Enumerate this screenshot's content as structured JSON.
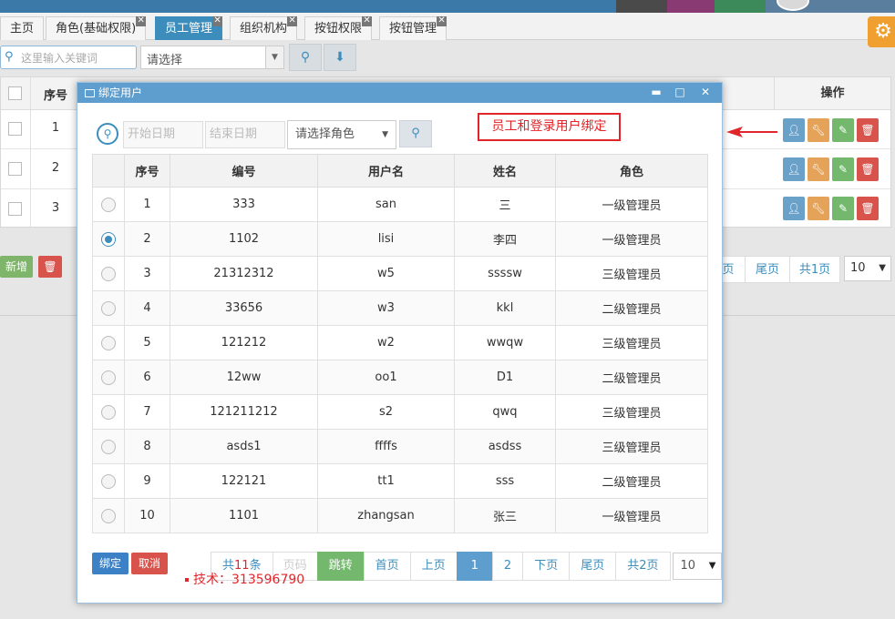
{
  "tabs": [
    {
      "label": "主页",
      "active": false
    },
    {
      "label": "角色(基础权限)",
      "active": false
    },
    {
      "label": "员工管理",
      "active": true
    },
    {
      "label": "组织机构",
      "active": false
    },
    {
      "label": "按钮权限",
      "active": false
    },
    {
      "label": "按钮管理",
      "active": false
    }
  ],
  "toolbar": {
    "search_placeholder": "这里输入关键词",
    "select_value": "请选择"
  },
  "bg_table": {
    "col_seq": "序号",
    "col_ops": "操作",
    "rows": [
      "1",
      "2",
      "3"
    ]
  },
  "bg_actions": {
    "add_label": "新增"
  },
  "bg_pager": {
    "prev": "页",
    "last": "尾页",
    "total": "共1页",
    "size": "10"
  },
  "annotation": {
    "text": "员工和登录用户绑定"
  },
  "tech_note": {
    "text": "技术：313596790"
  },
  "dialog": {
    "title": "绑定用户",
    "controls": {
      "min": "▬",
      "max": "□",
      "close": "✕"
    },
    "filters": {
      "start_date_placeholder": "开始日期",
      "end_date_placeholder": "结束日期",
      "role_select": "请选择角色"
    },
    "table": {
      "headers": [
        "序号",
        "编号",
        "用户名",
        "姓名",
        "角色"
      ],
      "rows": [
        {
          "seq": "1",
          "code": "333",
          "username": "san",
          "name": "三",
          "role": "一级管理员",
          "checked": false
        },
        {
          "seq": "2",
          "code": "1102",
          "username": "lisi",
          "name": "李四",
          "role": "一级管理员",
          "checked": true
        },
        {
          "seq": "3",
          "code": "21312312",
          "username": "w5",
          "name": "ssssw",
          "role": "三级管理员",
          "checked": false
        },
        {
          "seq": "4",
          "code": "33656",
          "username": "w3",
          "name": "kkl",
          "role": "二级管理员",
          "checked": false
        },
        {
          "seq": "5",
          "code": "121212",
          "username": "w2",
          "name": "wwqw",
          "role": "三级管理员",
          "checked": false
        },
        {
          "seq": "6",
          "code": "12ww",
          "username": "oo1",
          "name": "D1",
          "role": "二级管理员",
          "checked": false
        },
        {
          "seq": "7",
          "code": "121211212",
          "username": "s2",
          "name": "qwq",
          "role": "三级管理员",
          "checked": false
        },
        {
          "seq": "8",
          "code": "asds1",
          "username": "ffffs",
          "name": "asdss",
          "role": "三级管理员",
          "checked": false
        },
        {
          "seq": "9",
          "code": "122121",
          "username": "tt1",
          "name": "sss",
          "role": "二级管理员",
          "checked": false
        },
        {
          "seq": "10",
          "code": "1101",
          "username": "zhangsan",
          "name": "张三",
          "role": "一级管理员",
          "checked": false
        }
      ]
    },
    "buttons": {
      "bind": "绑定",
      "cancel": "取消"
    },
    "pager": {
      "total_prefix": "共",
      "total_count": "11",
      "total_suffix": "条",
      "page_input_placeholder": "页码",
      "jump": "跳转",
      "first": "首页",
      "prev": "上页",
      "page1": "1",
      "page2": "2",
      "next": "下页",
      "last": "尾页",
      "total_pages": "共2页",
      "size": "10"
    }
  },
  "colors": {
    "primary": "#3c8dbc",
    "title_bar": "#5d9ece",
    "danger": "#d7534c",
    "success": "#73b86d",
    "warning": "#e5a35a",
    "annotation": "#e0262a"
  }
}
